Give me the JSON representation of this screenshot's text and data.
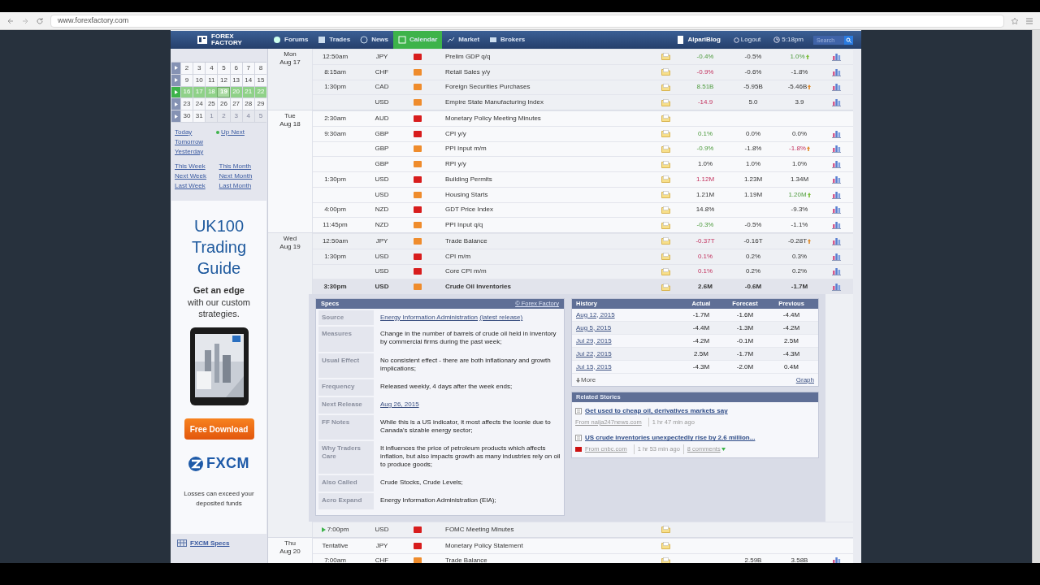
{
  "browser": {
    "url": "www.forexfactory.com"
  },
  "header": {
    "logo_lines": [
      "FOREX",
      "FACTORY"
    ],
    "nav": [
      {
        "label": "Forums",
        "selected": false
      },
      {
        "label": "Trades",
        "selected": false
      },
      {
        "label": "News",
        "selected": false
      },
      {
        "label": "Calendar",
        "selected": true
      },
      {
        "label": "Market",
        "selected": false
      },
      {
        "label": "Brokers",
        "selected": false
      }
    ],
    "blog": "AlpariBlog",
    "logout": "Logout",
    "time": "5:18pm",
    "search": {
      "placeholder": "Search"
    }
  },
  "sidebar": {
    "weeks": [
      {
        "current": false,
        "days": [
          {
            "label": "2",
            "selected": false,
            "other_month": false
          },
          {
            "label": "3",
            "selected": false,
            "other_month": false
          },
          {
            "label": "4",
            "selected": false,
            "other_month": false
          },
          {
            "label": "5",
            "selected": false,
            "other_month": false
          },
          {
            "label": "6",
            "selected": false,
            "other_month": false
          },
          {
            "label": "7",
            "selected": false,
            "other_month": false
          },
          {
            "label": "8",
            "selected": false,
            "other_month": false
          }
        ]
      },
      {
        "current": false,
        "days": [
          {
            "label": "9",
            "selected": false,
            "other_month": false
          },
          {
            "label": "10",
            "selected": false,
            "other_month": false
          },
          {
            "label": "11",
            "selected": false,
            "other_month": false
          },
          {
            "label": "12",
            "selected": false,
            "other_month": false
          },
          {
            "label": "13",
            "selected": false,
            "other_month": false
          },
          {
            "label": "14",
            "selected": false,
            "other_month": false
          },
          {
            "label": "15",
            "selected": false,
            "other_month": false
          }
        ]
      },
      {
        "current": true,
        "days": [
          {
            "label": "16",
            "selected": false,
            "other_month": false
          },
          {
            "label": "17",
            "selected": false,
            "other_month": false
          },
          {
            "label": "18",
            "selected": false,
            "other_month": false
          },
          {
            "label": "19",
            "selected": true,
            "other_month": false
          },
          {
            "label": "20",
            "selected": false,
            "other_month": false
          },
          {
            "label": "21",
            "selected": false,
            "other_month": false
          },
          {
            "label": "22",
            "selected": false,
            "other_month": false
          }
        ]
      },
      {
        "current": false,
        "days": [
          {
            "label": "23",
            "selected": false,
            "other_month": false
          },
          {
            "label": "24",
            "selected": false,
            "other_month": false
          },
          {
            "label": "25",
            "selected": false,
            "other_month": false
          },
          {
            "label": "26",
            "selected": false,
            "other_month": false
          },
          {
            "label": "27",
            "selected": false,
            "other_month": false
          },
          {
            "label": "28",
            "selected": false,
            "other_month": false
          },
          {
            "label": "29",
            "selected": false,
            "other_month": false
          }
        ]
      },
      {
        "current": false,
        "days": [
          {
            "label": "30",
            "selected": false,
            "other_month": false
          },
          {
            "label": "31",
            "selected": false,
            "other_month": false
          },
          {
            "label": "1",
            "selected": false,
            "other_month": true
          },
          {
            "label": "2",
            "selected": false,
            "other_month": true
          },
          {
            "label": "3",
            "selected": false,
            "other_month": true
          },
          {
            "label": "4",
            "selected": false,
            "other_month": true
          },
          {
            "label": "5",
            "selected": false,
            "other_month": true
          }
        ]
      }
    ],
    "links_left": [
      "Today",
      "Tomorrow",
      "Yesterday"
    ],
    "up_next": "Up Next",
    "period_links": [
      [
        "This Week",
        "This Month"
      ],
      [
        "Next Week",
        "Next Month"
      ],
      [
        "Last Week",
        "Last Month"
      ]
    ],
    "ad": {
      "title_lines": [
        "UK100",
        "Trading",
        "Guide"
      ],
      "lead": "Get an edge",
      "text": "with our custom strategies.",
      "button": "Free Download",
      "brand": "FXCM",
      "disclaimer": "Losses can exceed your deposited funds"
    },
    "specs_link": "FXCM Specs"
  },
  "days": [
    {
      "day": "Mon",
      "date": "Aug 17",
      "events": [
        {
          "time": "12:50am",
          "currency": "JPY",
          "high_impact": true,
          "event": "Prelim GDP q/q",
          "actual": "-0.4%",
          "actual_better": true,
          "actual_worse": false,
          "forecast": "-0.5%",
          "previous": "1.0%",
          "previous_better": true,
          "previous_worse": false,
          "revised": true,
          "graph": true
        },
        {
          "time": "8:15am",
          "currency": "CHF",
          "high_impact": false,
          "event": "Retail Sales y/y",
          "actual": "-0.9%",
          "actual_better": false,
          "actual_worse": true,
          "forecast": "-0.6%",
          "previous": "-1.8%",
          "previous_better": false,
          "previous_worse": false,
          "revised": false,
          "graph": true
        },
        {
          "time": "1:30pm",
          "currency": "CAD",
          "high_impact": false,
          "event": "Foreign Securities Purchases",
          "actual": "8.51B",
          "actual_better": true,
          "actual_worse": false,
          "forecast": "-5.95B",
          "previous": "-5.46B",
          "previous_better": false,
          "previous_worse": false,
          "revised": true,
          "graph": true
        },
        {
          "currency": "USD",
          "high_impact": false,
          "event": "Empire State Manufacturing Index",
          "actual": "-14.9",
          "actual_better": false,
          "actual_worse": true,
          "forecast": "5.0",
          "previous": "3.9",
          "previous_better": false,
          "previous_worse": false,
          "revised": false,
          "graph": true
        }
      ]
    },
    {
      "day": "Tue",
      "date": "Aug 18",
      "events": [
        {
          "time": "2:30am",
          "currency": "AUD",
          "high_impact": true,
          "event": "Monetary Policy Meeting Minutes",
          "graph": false
        },
        {
          "time": "9:30am",
          "currency": "GBP",
          "high_impact": true,
          "event": "CPI y/y",
          "actual": "0.1%",
          "actual_better": true,
          "actual_worse": false,
          "forecast": "0.0%",
          "previous": "0.0%",
          "previous_better": false,
          "previous_worse": false,
          "revised": false,
          "graph": true
        },
        {
          "currency": "GBP",
          "high_impact": false,
          "event": "PPI Input m/m",
          "actual": "-0.9%",
          "actual_better": true,
          "actual_worse": false,
          "forecast": "-1.8%",
          "previous": "-1.8%",
          "previous_better": false,
          "previous_worse": true,
          "revised": true,
          "graph": true
        },
        {
          "currency": "GBP",
          "high_impact": false,
          "event": "RPI y/y",
          "actual": "1.0%",
          "actual_better": false,
          "actual_worse": false,
          "forecast": "1.0%",
          "previous": "1.0%",
          "previous_better": false,
          "previous_worse": false,
          "revised": false,
          "graph": true
        },
        {
          "time": "1:30pm",
          "currency": "USD",
          "high_impact": true,
          "event": "Building Permits",
          "actual": "1.12M",
          "actual_better": false,
          "actual_worse": true,
          "forecast": "1.23M",
          "previous": "1.34M",
          "previous_better": false,
          "previous_worse": false,
          "revised": false,
          "graph": true
        },
        {
          "currency": "USD",
          "high_impact": false,
          "event": "Housing Starts",
          "actual": "1.21M",
          "actual_better": false,
          "actual_worse": false,
          "forecast": "1.19M",
          "previous": "1.20M",
          "previous_better": true,
          "previous_worse": false,
          "revised": true,
          "graph": true
        },
        {
          "time": "4:00pm",
          "currency": "NZD",
          "high_impact": true,
          "event": "GDT Price Index",
          "actual": "14.8%",
          "actual_better": false,
          "actual_worse": false,
          "previous": "-9.3%",
          "previous_better": false,
          "previous_worse": false,
          "revised": false,
          "graph": true
        },
        {
          "time": "11:45pm",
          "currency": "NZD",
          "high_impact": false,
          "event": "PPI Input q/q",
          "actual": "-0.3%",
          "actual_better": true,
          "actual_worse": false,
          "forecast": "-0.5%",
          "previous": "-1.1%",
          "previous_better": false,
          "previous_worse": false,
          "revised": false,
          "graph": true
        }
      ]
    },
    {
      "day": "Wed",
      "date": "Aug 19",
      "events": [
        {
          "time": "12:50am",
          "currency": "JPY",
          "high_impact": false,
          "event": "Trade Balance",
          "actual": "-0.37T",
          "actual_better": false,
          "actual_worse": true,
          "forecast": "-0.16T",
          "previous": "-0.28T",
          "previous_better": false,
          "previous_worse": false,
          "revised": true,
          "graph": true
        },
        {
          "time": "1:30pm",
          "currency": "USD",
          "high_impact": true,
          "event": "CPI m/m",
          "actual": "0.1%",
          "actual_better": false,
          "actual_worse": true,
          "forecast": "0.2%",
          "previous": "0.3%",
          "previous_better": false,
          "previous_worse": false,
          "revised": false,
          "graph": true
        },
        {
          "currency": "USD",
          "high_impact": true,
          "event": "Core CPI m/m",
          "actual": "0.1%",
          "actual_better": false,
          "actual_worse": true,
          "forecast": "0.2%",
          "previous": "0.2%",
          "previous_better": false,
          "previous_worse": false,
          "revised": false,
          "graph": true
        },
        {
          "time": "3:30pm",
          "currency": "USD",
          "high_impact": false,
          "event": "Crude Oil Inventories",
          "actual": "2.6M",
          "actual_better": false,
          "actual_worse": false,
          "forecast": "-0.6M",
          "previous": "-1.7M",
          "previous_better": false,
          "previous_worse": false,
          "revised": false,
          "graph": true,
          "expanded": true
        },
        {
          "time": "7:00pm",
          "currency": "USD",
          "high_impact": true,
          "event": "FOMC Meeting Minutes",
          "up_next": true,
          "graph": false
        }
      ]
    },
    {
      "day": "Thu",
      "date": "Aug 20",
      "events": [
        {
          "time": "Tentative",
          "currency": "JPY",
          "high_impact": true,
          "event": "Monetary Policy Statement",
          "graph": false
        },
        {
          "time": "7:00am",
          "currency": "CHF",
          "high_impact": false,
          "event": "Trade Balance",
          "forecast": "2.59B",
          "previous": "3.58B",
          "previous_better": false,
          "previous_worse": false,
          "revised": false,
          "graph": true
        }
      ]
    }
  ],
  "detail": {
    "specs": {
      "title": "Specs",
      "credit": "© Forex Factory",
      "rows": [
        {
          "label": "Source",
          "kind": "source",
          "link": "Energy Information Administration",
          "sublink": "(latest release)"
        },
        {
          "label": "Measures",
          "kind": "text",
          "value": "Change in the number of barrels of crude oil held in inventory by commercial firms during the past week;"
        },
        {
          "label": "Usual Effect",
          "kind": "text",
          "value": "No consistent effect - there are both inflationary and growth implications;"
        },
        {
          "label": "Frequency",
          "kind": "text",
          "value": "Released weekly, 4 days after the week ends;"
        },
        {
          "label": "Next Release",
          "kind": "link",
          "value": "Aug 26, 2015"
        },
        {
          "label": "FF Notes",
          "kind": "text",
          "value": "While this is a US indicator, it most affects the loonie due to Canada's sizable energy sector;"
        },
        {
          "label": "Why Traders Care",
          "kind": "text",
          "value": "It influences the price of petroleum products which affects inflation, but also impacts growth as many industries rely on oil to produce goods;"
        },
        {
          "label": "Also Called",
          "kind": "text",
          "value": "Crude Stocks, Crude Levels;"
        },
        {
          "label": "Acro Expand",
          "kind": "text",
          "value": "Energy Information Administration (EIA);"
        }
      ]
    },
    "history": {
      "columns": [
        "History",
        "Actual",
        "Forecast",
        "Previous"
      ],
      "rows": [
        [
          "Aug 12, 2015",
          "-1.7M",
          "-1.6M",
          "-4.4M"
        ],
        [
          "Aug 5, 2015",
          "-4.4M",
          "-1.3M",
          "-4.2M"
        ],
        [
          "Jul 29, 2015",
          "-4.2M",
          "-0.1M",
          "2.5M"
        ],
        [
          "Jul 22, 2015",
          "2.5M",
          "-1.7M",
          "-4.3M"
        ],
        [
          "Jul 15, 2015",
          "-4.3M",
          "-2.0M",
          "0.4M"
        ]
      ],
      "more": "More",
      "graph": "Graph"
    },
    "stories": {
      "title": "Related Stories",
      "items": [
        {
          "headline": "Get used to cheap oil, derivatives markets say",
          "source": "From naija247news.com",
          "age": "1 hr 47 min ago",
          "source_logo": false
        },
        {
          "headline": "US crude inventories unexpectedly rise by 2.6 million...",
          "source": "From cnbc.com",
          "age": "1 hr 53 min ago",
          "comments": "8 comments",
          "source_logo": true
        }
      ]
    }
  }
}
